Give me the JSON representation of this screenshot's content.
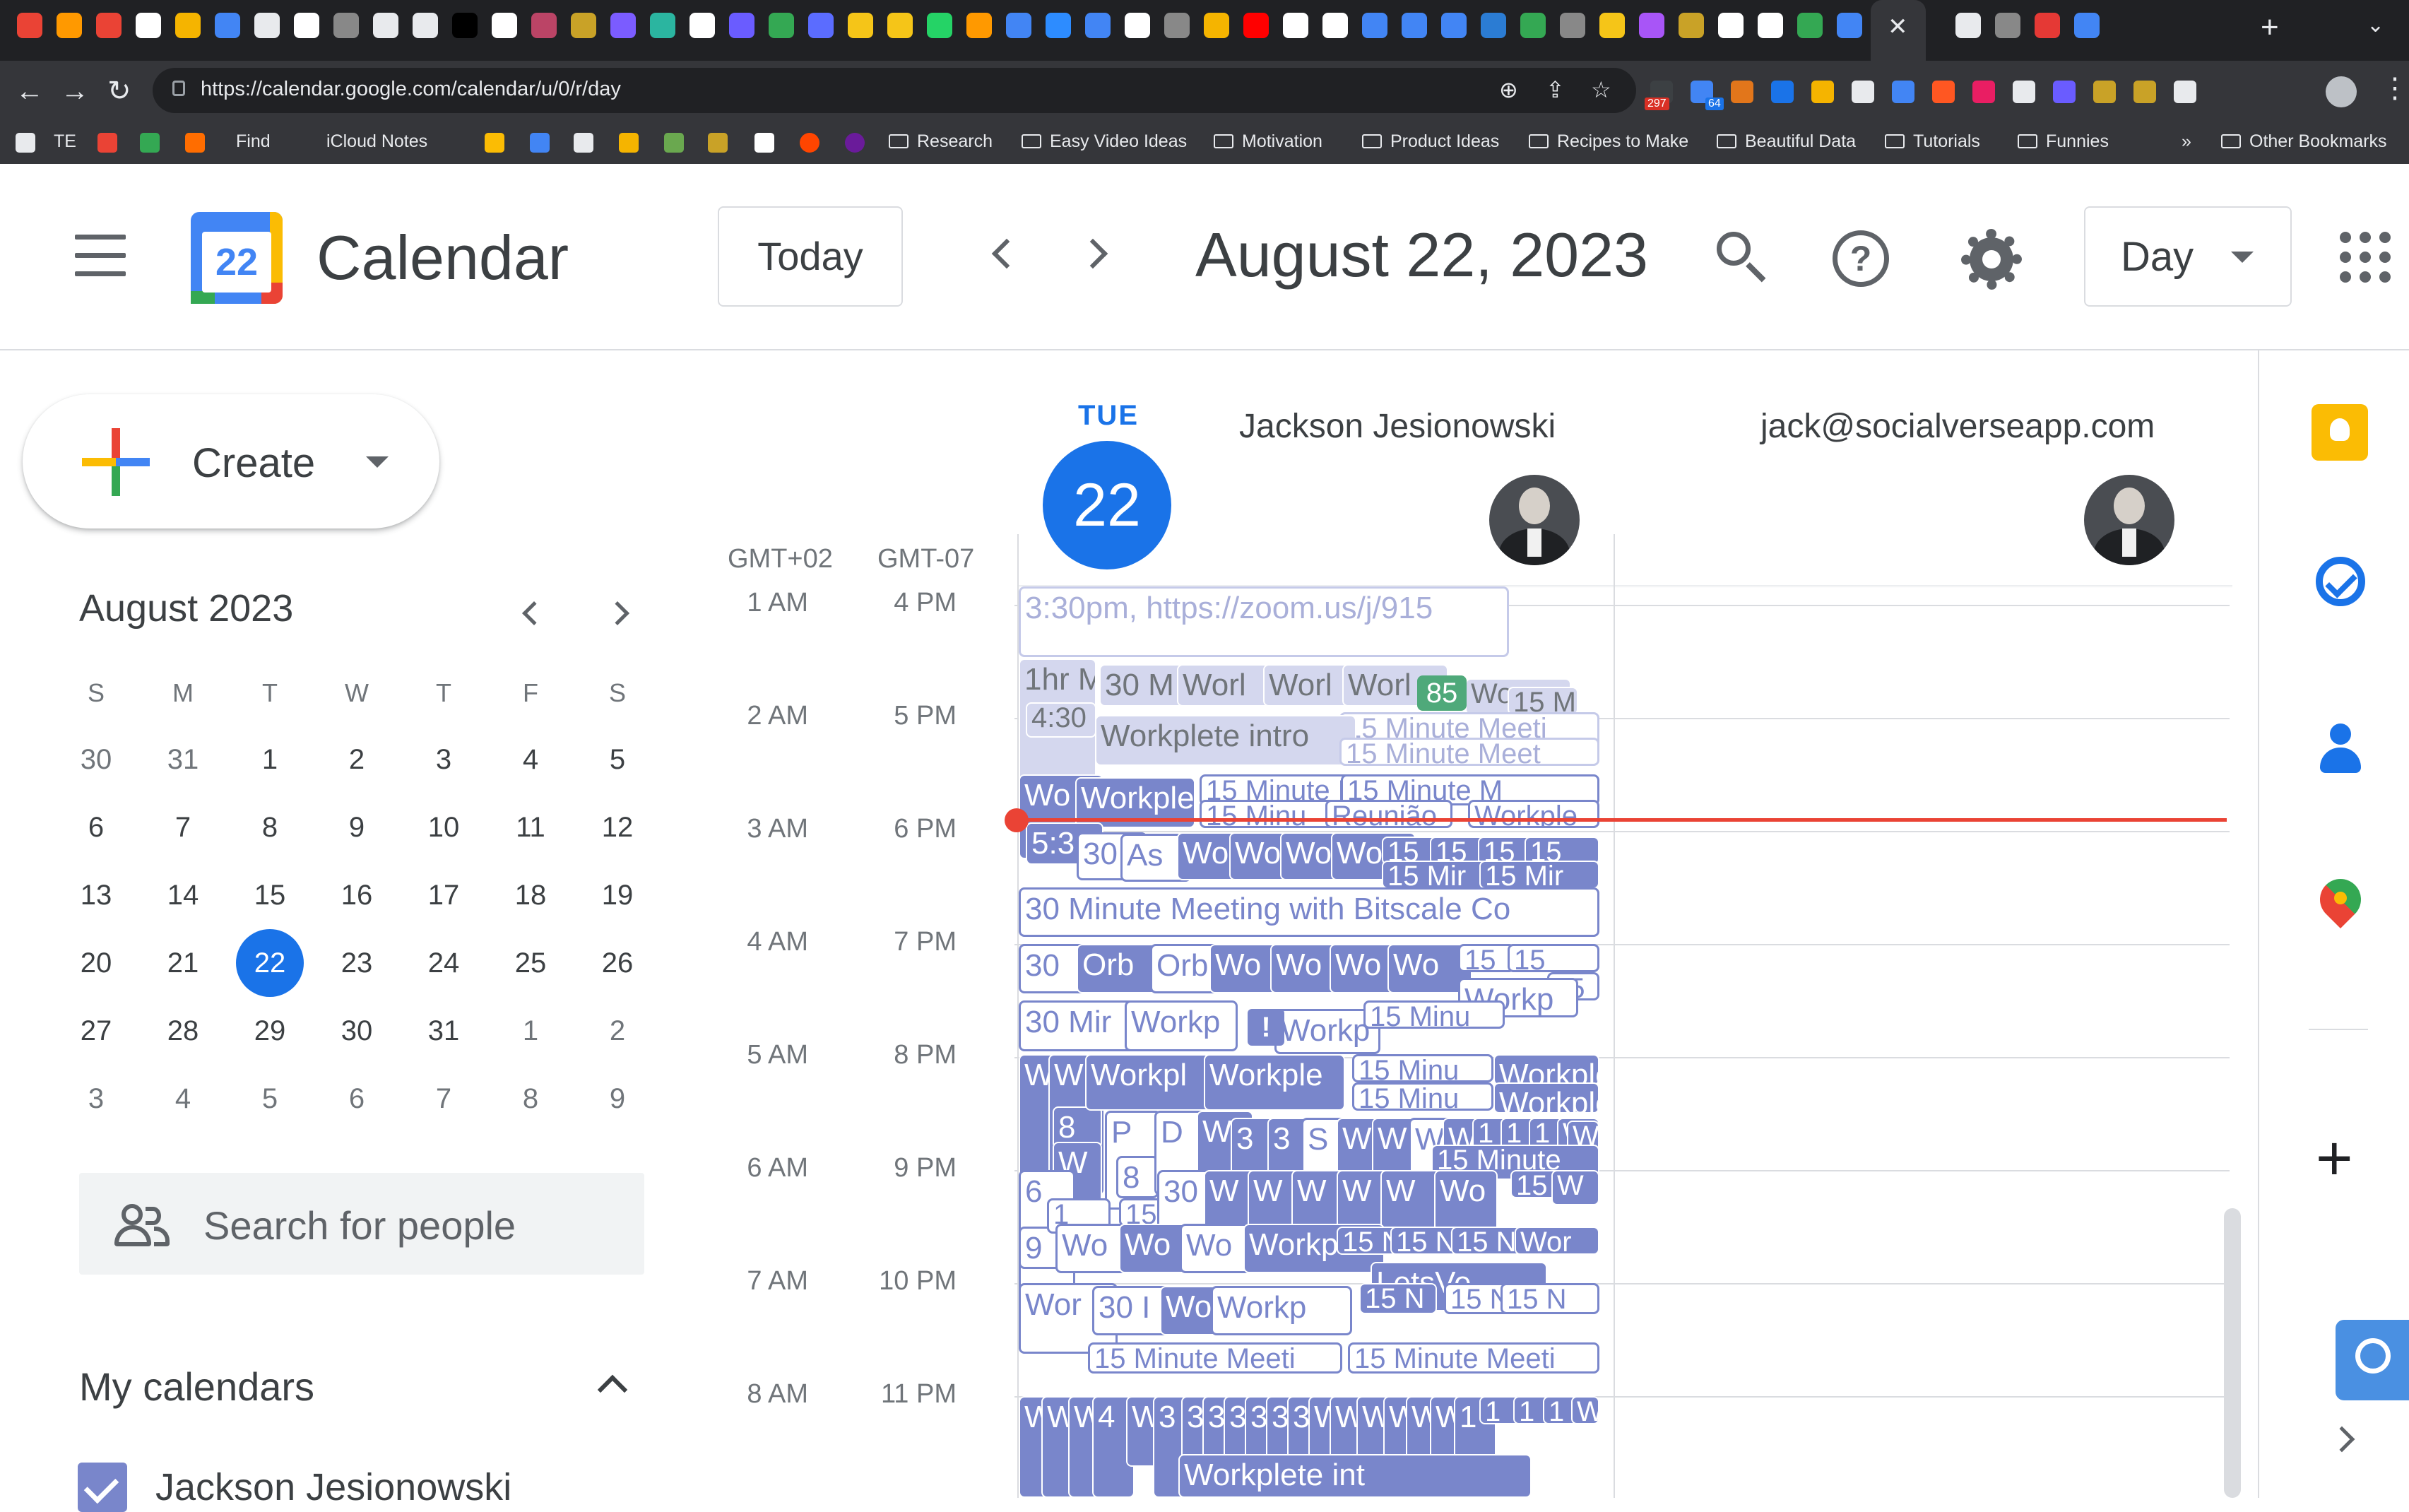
{
  "browser": {
    "url": "https://calendar.google.com/calendar/u/0/r/day",
    "url_host": "calendar.google.com",
    "bookmarks": [
      "TE",
      "Find",
      "iCloud Notes",
      "Research",
      "Easy Video Ideas",
      "Motivation",
      "Product Ideas",
      "Recipes to Make",
      "Beautiful Data",
      "Tutorials",
      "Funnies",
      "Other Bookmarks"
    ],
    "extension_badges": [
      "297",
      "64"
    ],
    "tab_overflow": "»"
  },
  "header": {
    "app_name": "Calendar",
    "logo_day": "22",
    "today_label": "Today",
    "date_title": "August 22, 2023",
    "view_label": "Day",
    "icons": [
      "menu-icon",
      "search-icon",
      "help-icon",
      "settings-icon",
      "apps-grid-icon"
    ]
  },
  "sidebar": {
    "create_label": "Create",
    "mini_month": "August 2023",
    "weekdays": [
      "S",
      "M",
      "T",
      "W",
      "T",
      "F",
      "S"
    ],
    "weeks": [
      [
        "30",
        "31",
        "1",
        "2",
        "3",
        "4",
        "5"
      ],
      [
        "6",
        "7",
        "8",
        "9",
        "10",
        "11",
        "12"
      ],
      [
        "13",
        "14",
        "15",
        "16",
        "17",
        "18",
        "19"
      ],
      [
        "20",
        "21",
        "22",
        "23",
        "24",
        "25",
        "26"
      ],
      [
        "27",
        "28",
        "29",
        "30",
        "31",
        "1",
        "2"
      ],
      [
        "3",
        "4",
        "5",
        "6",
        "7",
        "8",
        "9"
      ]
    ],
    "selected_day": "22",
    "people_search_placeholder": "Search for people",
    "my_calendars_title": "My calendars",
    "my_calendars": [
      "Jackson Jesionowski"
    ]
  },
  "day_view": {
    "day_of_week": "TUE",
    "day_number": "22",
    "timezones": [
      "GMT+02",
      "GMT-07"
    ],
    "hours_primary": [
      "1 AM",
      "2 AM",
      "3 AM",
      "4 AM",
      "5 AM",
      "6 AM",
      "7 AM",
      "8 AM"
    ],
    "hours_secondary": [
      "4 PM",
      "5 PM",
      "6 PM",
      "7 PM",
      "8 PM",
      "9 PM",
      "10 PM",
      "11 PM"
    ],
    "people": [
      {
        "name": "Jackson Jesionowski"
      },
      {
        "name": "jack@socialverseapp.com"
      }
    ],
    "badge_count": "85",
    "alert_symbol": "!",
    "events": [
      "3:30pm, https://zoom.us/j/915",
      "1hr M",
      "4:30",
      "30 M",
      "Worl",
      "Worl",
      "Worl",
      "Wor",
      "15 M",
      "15 Minute Meeti",
      "Workplete intro",
      "15 Minute Meet",
      "Wo",
      "Workple",
      "15 Minute M",
      "15 Minute M",
      "15 Minu",
      "Reunião",
      "Workple",
      "5:3",
      "30",
      "As",
      "Wo",
      "Wo",
      "Wo",
      "Wo",
      "15",
      "15",
      "15",
      "15",
      "15 Mir",
      "15 Mir",
      "30 Minute Meeting with Bitscale Co",
      "30",
      "Orb",
      "Orb",
      "Wo",
      "Wo",
      "Wo",
      "Wo",
      "15",
      "15",
      "15",
      "Workp",
      "30 Mir",
      "Workp",
      "Workp",
      "15 Minu",
      "W",
      "W",
      "8",
      "Workpl",
      "Workple",
      "15 Minu",
      "15 Minu",
      "Workple",
      "Workple",
      "W",
      "P",
      "8",
      "D",
      "W",
      "3",
      "3",
      "S",
      "W",
      "W",
      "W",
      "W",
      "1",
      "1",
      "1",
      "W",
      "W",
      "15 Minute",
      "6",
      "9",
      "1",
      "15 M",
      "30",
      "W",
      "W",
      "W",
      "W",
      "W",
      "Wo",
      "15",
      "W",
      "Wo",
      "Wo",
      "Wo",
      "Workp",
      "15 N",
      "15 N",
      "15 N",
      "Wor",
      "LetsVe",
      "Wor",
      "30 I",
      "Wor",
      "Workp",
      "15 N",
      "15 N",
      "15 N",
      "15 Minute Meeti",
      "15 Minute Meeti",
      "W",
      "W",
      "W",
      "4",
      "W",
      "3",
      "3",
      "3",
      "3",
      "3",
      "3",
      "3",
      "W",
      "W",
      "W",
      "W",
      "W",
      "W",
      "1",
      "1",
      "1",
      "1",
      "Workplete introducto",
      "Workplete int"
    ]
  },
  "side_panel": {
    "icons": [
      "keep-icon",
      "tasks-icon",
      "contacts-icon",
      "maps-icon",
      "add-icon",
      "expand-icon"
    ]
  },
  "colors": {
    "accent": "#1a73e8",
    "event_lavender": "#7986cb",
    "now_line": "#ea4335",
    "chrome_dark": "#202124"
  }
}
